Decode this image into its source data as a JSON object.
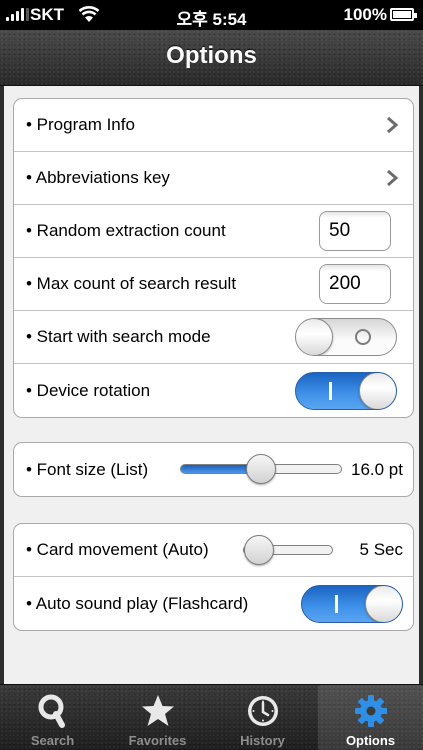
{
  "status_bar": {
    "carrier": "SKT",
    "time": "오후 5:54",
    "battery": "100%"
  },
  "nav": {
    "title": "Options"
  },
  "groups": {
    "general": [
      {
        "label": "• Program Info"
      },
      {
        "label": "• Abbreviations key"
      },
      {
        "label": "• Random extraction count",
        "value": "50"
      },
      {
        "label": "• Max count of search result",
        "value": "200"
      },
      {
        "label": "• Start with search mode",
        "switch_on": false
      },
      {
        "label": "• Device rotation",
        "switch_on": true
      }
    ],
    "font": {
      "label": "• Font size (List)",
      "value_text": "16.0 pt",
      "slider_fraction": 0.5
    },
    "card": [
      {
        "label": "• Card movement (Auto)",
        "value_text": "5 Sec",
        "slider_fraction": 0.18
      },
      {
        "label": "• Auto sound play (Flashcard)",
        "switch_on": true
      }
    ]
  },
  "tabs": [
    {
      "label": "Search",
      "icon": "search-icon",
      "selected": false
    },
    {
      "label": "Favorites",
      "icon": "star-icon",
      "selected": false
    },
    {
      "label": "History",
      "icon": "clock-icon",
      "selected": false
    },
    {
      "label": "Options",
      "icon": "gear-icon",
      "selected": true
    }
  ],
  "colors": {
    "accent_blue": "#3d8fe8",
    "tab_selected_icon": "#2f8fe6",
    "tab_icon": "#e8e8e8"
  }
}
